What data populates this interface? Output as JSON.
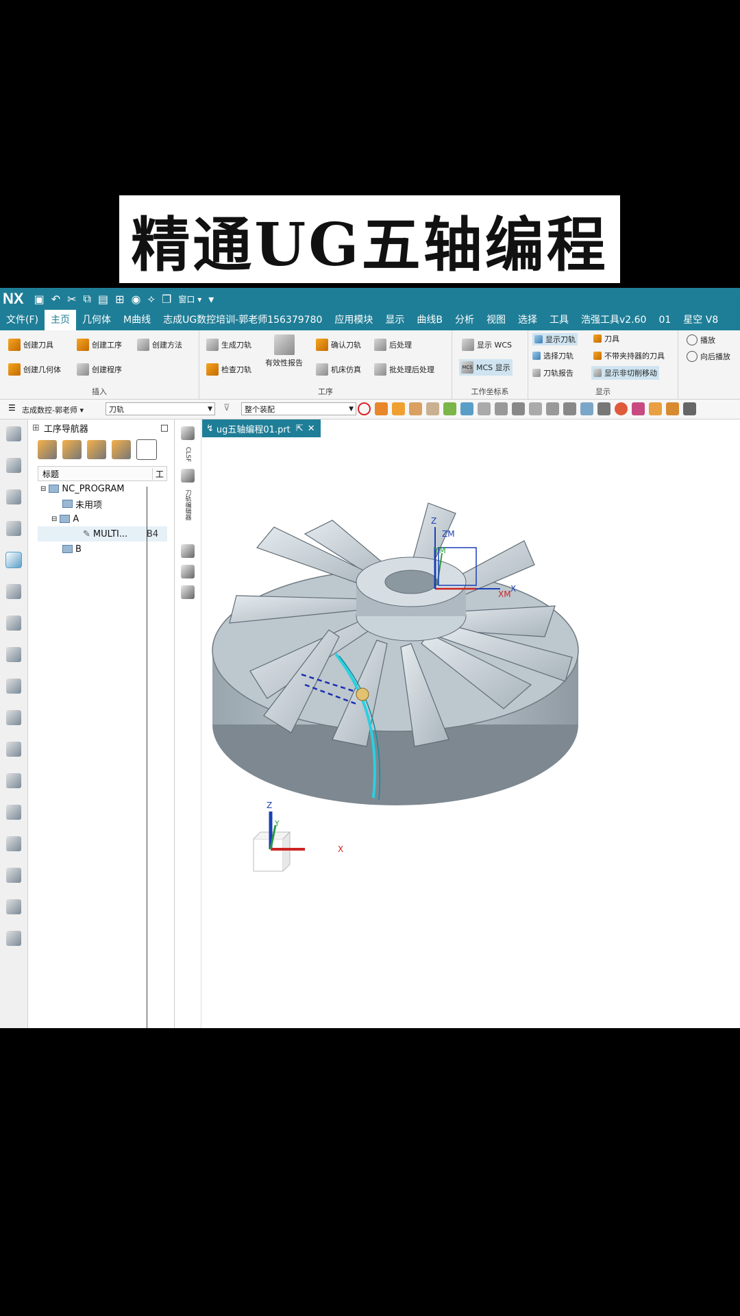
{
  "banner": {
    "title": "精通UG五轴编程"
  },
  "app": {
    "logo": "NX",
    "window_menu": "窗口"
  },
  "menu": [
    "文件(F)",
    "主页",
    "几何体",
    "M曲线",
    "志成UG数控培训-郭老师156379780",
    "应用模块",
    "显示",
    "曲线B",
    "分析",
    "视图",
    "选择",
    "工具",
    "浩强工具v2.60",
    "01",
    "星空 V8"
  ],
  "ribbon": {
    "insert": {
      "create_tool": "创建刀具",
      "create_operation": "创建工序",
      "create_method": "创建方法",
      "create_geometry": "创建几何体",
      "create_program": "创建程序",
      "group": "插入"
    },
    "operation": {
      "generate": "生成刀轨",
      "validity_report": "有效性报告",
      "verify": "确认刀轨",
      "postprocess": "后处理",
      "check": "检查刀轨",
      "simulate": "机床仿真",
      "batch_post": "批处理后处理",
      "group": "工序"
    },
    "wcs": {
      "show_wcs": "显示 WCS",
      "mcs_show": "MCS 显示",
      "mcs_tag": "MCS",
      "group": "工作坐标系"
    },
    "display": {
      "show_path": "显示刀轨",
      "tool": "刀具",
      "select_path": "选择刀轨",
      "no_holder": "不带夹持器的刀具",
      "path_report": "刀轨报告",
      "noncut": "显示非切削移动",
      "group": "显示"
    },
    "playback": {
      "play": "播放",
      "forward_backward": "向后播放"
    }
  },
  "toolbar": {
    "filter": "志成数控-郭老师",
    "type_filter": "刀轨",
    "scope": "整个装配"
  },
  "navigator": {
    "title": "工序导航器",
    "col_name": "标题",
    "col_tool": "工",
    "rows": [
      {
        "label": "NC_PROGRAM",
        "tool": ""
      },
      {
        "label": "未用项",
        "tool": ""
      },
      {
        "label": "A",
        "tool": ""
      },
      {
        "label": "MULTI...",
        "tool": "B4"
      },
      {
        "label": "B",
        "tool": ""
      }
    ]
  },
  "side_panel": {
    "clsf": "CLSF",
    "vertical_label": "刀轨编辑器"
  },
  "document_tab": {
    "name": "ug五轴编程01.prt"
  },
  "viewport": {
    "axis_x": "X",
    "axis_y": "Y",
    "axis_z": "Z",
    "axis_xm": "XM",
    "axis_ym": "YM",
    "axis_zm": "ZM"
  },
  "colors": {
    "nx_teal": "#1f7e97",
    "part_gray": "#b8c3cc",
    "toolpath_cyan": "#2ad0e0",
    "axis_red": "#cc2222",
    "axis_blue": "#1a3fb5",
    "axis_green": "#2a9a3a"
  }
}
